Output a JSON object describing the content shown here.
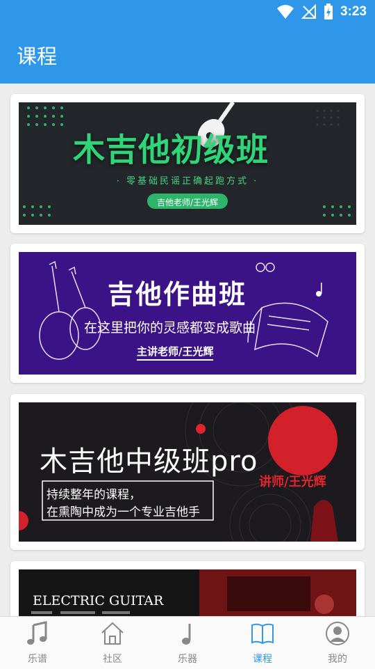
{
  "status_bar": {
    "time": "3:23"
  },
  "app_bar": {
    "title": "课程"
  },
  "courses": [
    {
      "title": "木吉他初级班",
      "subtitle": "· 零基础民谣正确起跑方式 ·",
      "teacher": "吉他老师/王光辉"
    },
    {
      "title": "吉他作曲班",
      "subtitle": "在这里把你的灵感都变成歌曲",
      "teacher": "主讲老师/王光辉"
    },
    {
      "title": "木吉他中级班pro",
      "line1": "持续整年的课程，",
      "line2": "在熏陶中成为一个专业吉他手",
      "teacher": "讲师/王光辉"
    },
    {
      "title": "ELECTRIC GUITAR"
    }
  ],
  "tabs": [
    {
      "label": "乐谱",
      "icon": "music-note-icon"
    },
    {
      "label": "社区",
      "icon": "home-icon"
    },
    {
      "label": "乐器",
      "icon": "single-note-icon"
    },
    {
      "label": "课程",
      "icon": "book-icon",
      "active": true
    },
    {
      "label": "我的",
      "icon": "profile-icon"
    }
  ],
  "colors": {
    "primary": "#2f97ea",
    "inactive": "#888888"
  }
}
